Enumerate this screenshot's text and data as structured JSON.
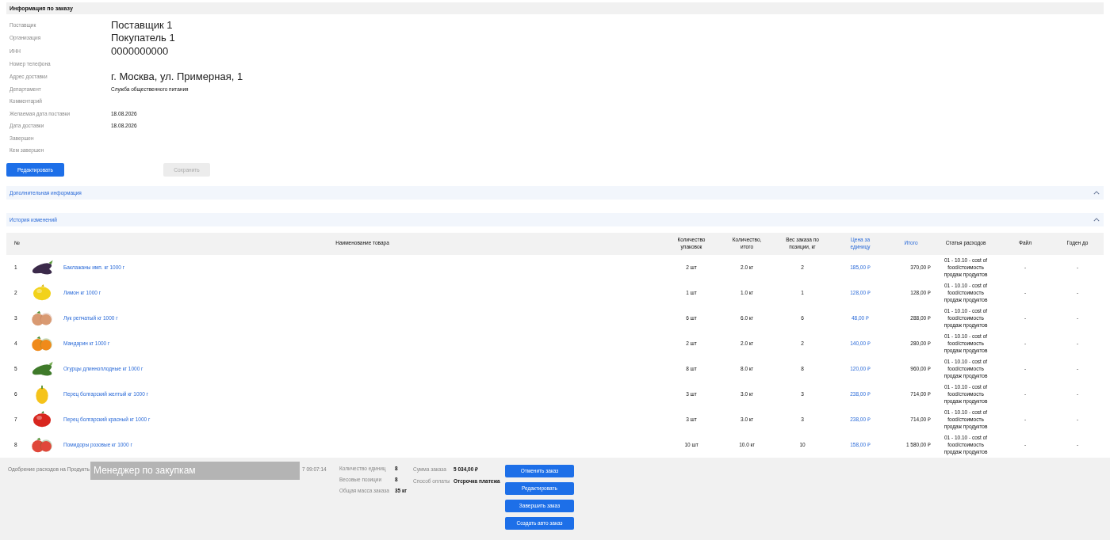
{
  "order_info": {
    "title": "Информация по заказу",
    "fields": [
      {
        "label": "Поставщик",
        "value": "Поставщик 1",
        "kind": "large"
      },
      {
        "label": "Организация",
        "value": "Покупатель 1",
        "kind": "large"
      },
      {
        "label": "ИНН",
        "value": "0000000000",
        "kind": "large"
      },
      {
        "label": "Номер телефона",
        "kind": "small"
      },
      {
        "label": "Адрес доставки",
        "value": "г. Москва, ул. Примерная, 1",
        "kind": "large"
      },
      {
        "label": "Департамент",
        "value": "Служба общественного питания",
        "kind": "small"
      },
      {
        "label": "Комментарий",
        "kind": "small"
      },
      {
        "label": "Желаемая дата поставки",
        "value": "18.08.2026",
        "kind": "small"
      },
      {
        "label": "Дата доставки",
        "value": "18.08.2026",
        "kind": "small"
      },
      {
        "label": "Завершен",
        "kind": "small"
      },
      {
        "label": "Кем завершен",
        "kind": "small"
      }
    ],
    "buttons": [
      {
        "label": "Редактировать",
        "disabled": false
      },
      {
        "label": "Сохранить",
        "disabled": true
      }
    ]
  },
  "sections": [
    {
      "title": "Дополнительная информация",
      "expanded": true
    },
    {
      "title": "История изменений",
      "expanded": true
    }
  ],
  "table": {
    "columns": [
      {
        "label": "№",
        "link": false
      },
      {
        "label": "Наименование товара",
        "link": false
      },
      {
        "label": "Количество упаковок",
        "link": false
      },
      {
        "label": "Количество, итого",
        "link": false
      },
      {
        "label": "Вес заказа по позиции, кг",
        "link": false
      },
      {
        "label": "Цена за единицу",
        "link": true
      },
      {
        "label": "Итого",
        "link": true
      },
      {
        "label": "Статья расходов",
        "link": false
      },
      {
        "label": "Файл",
        "link": false
      },
      {
        "label": "Годен до",
        "link": false
      }
    ],
    "rows": [
      {
        "n": "1",
        "name": "Баклажаны имп. кг 1000 г",
        "packs": "2 шт",
        "qty": "2.0 кг",
        "weight": "2",
        "price": "185,00 ₽",
        "total": "370,00 ₽",
        "expense": "01 - 10.10 - cost of food/стоимость продаж продуктов",
        "file": "-",
        "expiry": "-"
      },
      {
        "n": "2",
        "name": "Лимон кг 1000 г",
        "packs": "1 шт",
        "qty": "1.0 кг",
        "weight": "1",
        "price": "128,00 ₽",
        "total": "128,00 ₽",
        "expense": "01 - 10.10 - cost of food/стоимость продаж продуктов",
        "file": "-",
        "expiry": "-"
      },
      {
        "n": "3",
        "name": "Лук репчатый кг 1000 г",
        "packs": "6 шт",
        "qty": "6.0 кг",
        "weight": "6",
        "price": "48,00 ₽",
        "total": "288,00 ₽",
        "expense": "01 - 10.10 - cost of food/стоимость продаж продуктов",
        "file": "-",
        "expiry": "-"
      },
      {
        "n": "4",
        "name": "Мандарин кг 1000 г",
        "packs": "2 шт",
        "qty": "2.0 кг",
        "weight": "2",
        "price": "140,00 ₽",
        "total": "280,00 ₽",
        "expense": "01 - 10.10 - cost of food/стоимость продаж продуктов",
        "file": "-",
        "expiry": "-"
      },
      {
        "n": "5",
        "name": "Огурцы длинноплодные кг 1000 г",
        "packs": "8 шт",
        "qty": "8.0 кг",
        "weight": "8",
        "price": "120,00 ₽",
        "total": "960,00 ₽",
        "expense": "01 - 10.10 - cost of food/стоимость продаж продуктов",
        "file": "-",
        "expiry": "-"
      },
      {
        "n": "6",
        "name": "Перец болгарский желтый кг 1000 г",
        "packs": "3 шт",
        "qty": "3.0 кг",
        "weight": "3",
        "price": "238,00 ₽",
        "total": "714,00 ₽",
        "expense": "01 - 10.10 - cost of food/стоимость продаж продуктов",
        "file": "-",
        "expiry": "-"
      },
      {
        "n": "7",
        "name": "Перец болгарский красный кг 1000 г",
        "packs": "3 шт",
        "qty": "3.0 кг",
        "weight": "3",
        "price": "238,00 ₽",
        "total": "714,00 ₽",
        "expense": "01 - 10.10 - cost of food/стоимость продаж продуктов",
        "file": "-",
        "expiry": "-"
      },
      {
        "n": "8",
        "name": "Помидоры розовые кг 1000 г",
        "packs": "10 шт",
        "qty": "10.0 кг",
        "weight": "10",
        "price": "158,00 ₽",
        "total": "1 580,00 ₽",
        "expense": "01 - 10.10 - cost of food/стоимость продаж продуктов",
        "file": "-",
        "expiry": "-"
      }
    ]
  },
  "footer": {
    "approval": "Одобрение расходов на Продукть",
    "tooltip": "Менеджер по закупкам",
    "time": "7 09:07:14",
    "stats": [
      {
        "label": "Количество единиц",
        "value": "8"
      },
      {
        "label": "Весовые позиции",
        "value": "8"
      },
      {
        "label": "Общая масса заказа",
        "value": "35 кг"
      }
    ],
    "totals": [
      {
        "label": "Сумма заказа",
        "value": "5 034,00 ₽"
      },
      {
        "label": "Способ оплаты",
        "value": "Отсрочка платежа"
      }
    ],
    "buttons": [
      "Отменить заказ",
      "Редактировать",
      "Завершить заказ",
      "Создать авто заказ"
    ]
  }
}
